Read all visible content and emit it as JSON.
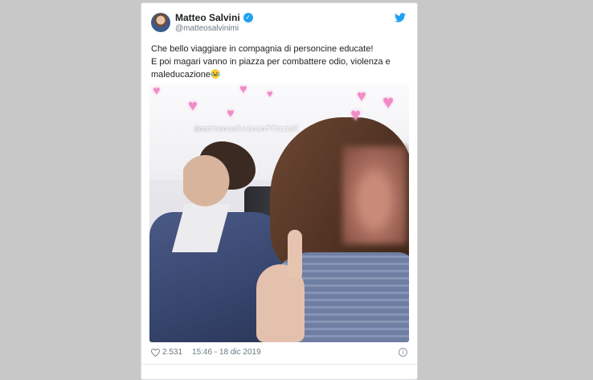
{
  "tweet": {
    "author_name": "Matteo Salvini",
    "author_handle": "@matteosalvinimi",
    "text_lines": [
      "Che bello viaggiare in compagnia di personcine educate!",
      "E poi magari vanno in piazza per combattere odio, violenza e",
      "maleducazione"
    ],
    "emoji": "face-with-tears-of-joy",
    "image_watermark": "@matteosalviniofficial",
    "likes": "2.531",
    "timestamp": "15:46 - 18 dic 2019"
  },
  "icons": {
    "verified": "verified-badge-icon",
    "brand": "twitter-bird-icon",
    "like": "heart-outline-icon",
    "info": "info-icon"
  },
  "colors": {
    "brand": "#1da1f2",
    "text": "#1c2022",
    "muted": "#697882",
    "page_background": "#c8c8c8",
    "heart_stickers": "#f08bc6"
  }
}
